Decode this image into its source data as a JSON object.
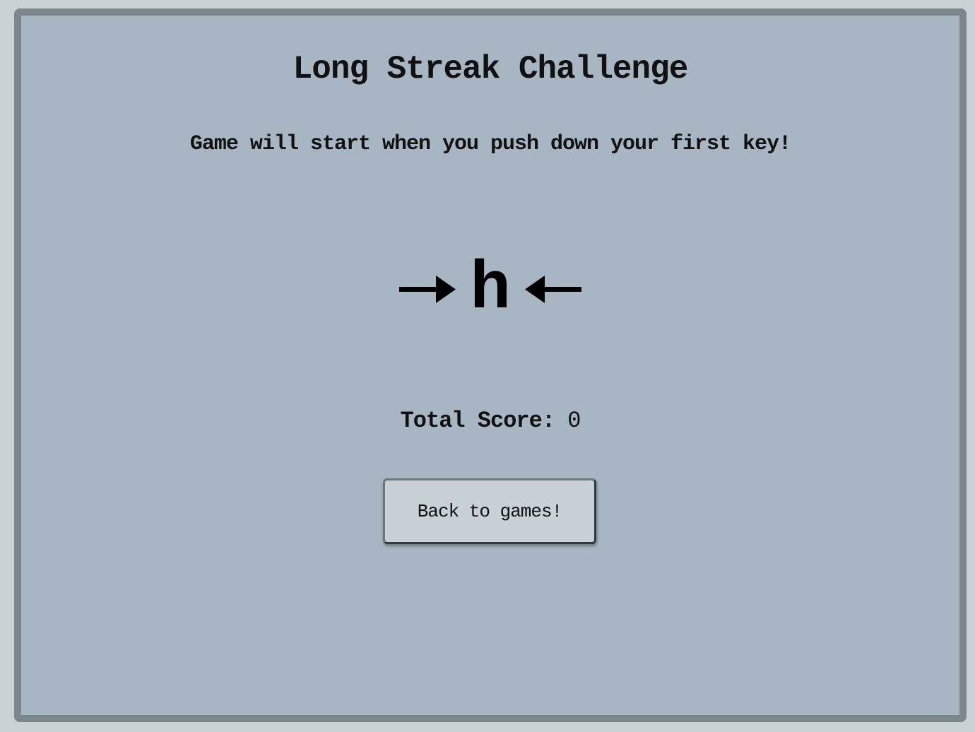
{
  "game": {
    "title": "Long Streak Challenge",
    "instructions": "Game will start when you push down your first key!",
    "target_key": "h",
    "left_arrow_icon": "right-arrow",
    "right_arrow_icon": "left-arrow",
    "score_label": "Total Score:",
    "score_value": "0",
    "back_button_label": "Back to games!"
  },
  "colors": {
    "page_background": "#c9d2d5",
    "panel_background": "#a8b6c3",
    "panel_border": "#7c878c",
    "button_background": "#c8d2d6",
    "text": "#111111"
  }
}
